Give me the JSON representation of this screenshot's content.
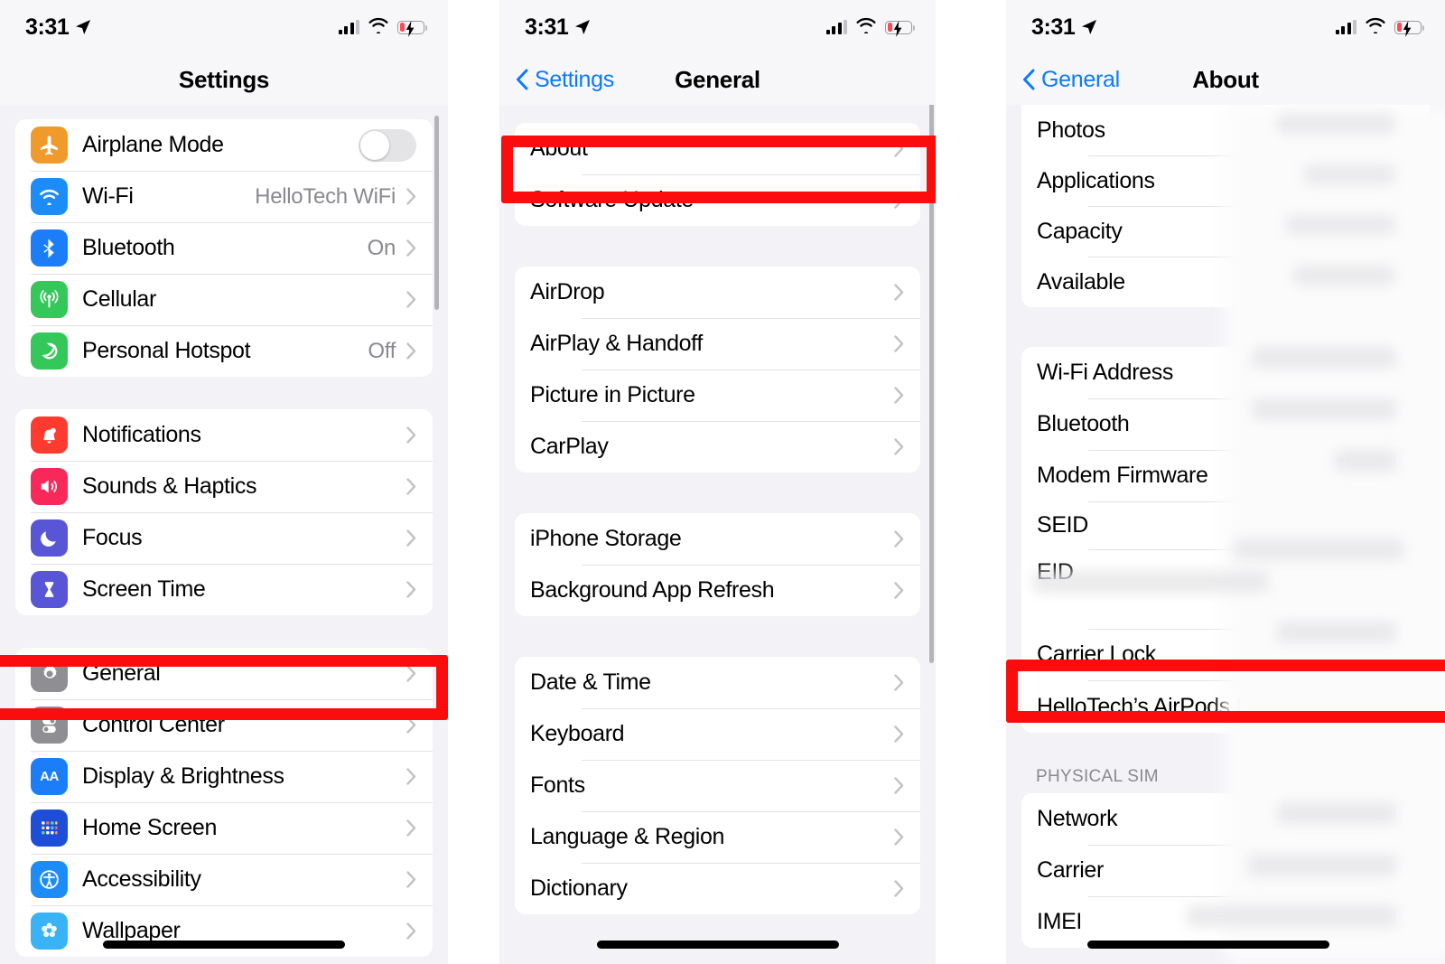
{
  "status_bar": {
    "time": "3:31",
    "location_icon": "location-arrow-icon",
    "signal_icon": "cellular-signal-icon",
    "wifi_icon": "wifi-icon",
    "battery_icon": "battery-charging-icon"
  },
  "panel_settings": {
    "title": "Settings",
    "groups": [
      {
        "rows": [
          {
            "label": "Airplane Mode",
            "icon": "airplane-icon",
            "color": "#f09a2b",
            "control": "toggle",
            "value": ""
          },
          {
            "label": "Wi-Fi",
            "icon": "wifi-icon",
            "color": "#1c8cf9",
            "control": "chevron",
            "value": "HelloTech WiFi"
          },
          {
            "label": "Bluetooth",
            "icon": "bluetooth-icon",
            "color": "#1c7df9",
            "control": "chevron",
            "value": "On"
          },
          {
            "label": "Cellular",
            "icon": "cellular-icon",
            "color": "#34c759",
            "control": "chevron",
            "value": ""
          },
          {
            "label": "Personal Hotspot",
            "icon": "hotspot-icon",
            "color": "#34c759",
            "control": "chevron",
            "value": "Off"
          }
        ]
      },
      {
        "rows": [
          {
            "label": "Notifications",
            "icon": "notifications-bell-icon",
            "color": "#ff3b30",
            "control": "chevron",
            "value": ""
          },
          {
            "label": "Sounds & Haptics",
            "icon": "sounds-speaker-icon",
            "color": "#f8285a",
            "control": "chevron",
            "value": ""
          },
          {
            "label": "Focus",
            "icon": "focus-moon-icon",
            "color": "#5856d6",
            "control": "chevron",
            "value": ""
          },
          {
            "label": "Screen Time",
            "icon": "screen-time-hourglass-icon",
            "color": "#5856d6",
            "control": "chevron",
            "value": ""
          }
        ]
      },
      {
        "rows": [
          {
            "label": "General",
            "icon": "gear-icon",
            "color": "#8e8e93",
            "control": "chevron",
            "value": ""
          },
          {
            "label": "Control Center",
            "icon": "control-center-icon",
            "color": "#8e8e93",
            "control": "chevron",
            "value": ""
          },
          {
            "label": "Display & Brightness",
            "icon": "display-brightness-aa-icon",
            "color": "#1c7df9",
            "control": "chevron",
            "value": ""
          },
          {
            "label": "Home Screen",
            "icon": "home-screen-grid-icon",
            "color": "#1e4ed8",
            "control": "chevron",
            "value": ""
          },
          {
            "label": "Accessibility",
            "icon": "accessibility-icon",
            "color": "#1c8cf9",
            "control": "chevron",
            "value": ""
          },
          {
            "label": "Wallpaper",
            "icon": "wallpaper-flower-icon",
            "color": "#39b3f5",
            "control": "chevron",
            "value": ""
          }
        ]
      }
    ],
    "highlight": "General"
  },
  "panel_general": {
    "title": "General",
    "back_label": "Settings",
    "groups": [
      {
        "rows": [
          {
            "label": "About"
          },
          {
            "label": "Software Update"
          }
        ]
      },
      {
        "rows": [
          {
            "label": "AirDrop"
          },
          {
            "label": "AirPlay & Handoff"
          },
          {
            "label": "Picture in Picture"
          },
          {
            "label": "CarPlay"
          }
        ]
      },
      {
        "rows": [
          {
            "label": "iPhone Storage"
          },
          {
            "label": "Background App Refresh"
          }
        ]
      },
      {
        "rows": [
          {
            "label": "Date & Time"
          },
          {
            "label": "Keyboard"
          },
          {
            "label": "Fonts"
          },
          {
            "label": "Language & Region"
          },
          {
            "label": "Dictionary"
          }
        ]
      }
    ],
    "highlight": "About"
  },
  "panel_about": {
    "title": "About",
    "back_label": "General",
    "groups": [
      {
        "header": "",
        "rows": [
          {
            "label": "Photos",
            "value": "",
            "redacted": true
          },
          {
            "label": "Applications",
            "value": "",
            "redacted": true
          },
          {
            "label": "Capacity",
            "value": "",
            "redacted": true
          },
          {
            "label": "Available",
            "value": "",
            "redacted": true
          }
        ]
      },
      {
        "header": "",
        "rows": [
          {
            "label": "Wi-Fi Address",
            "value": "",
            "redacted": true
          },
          {
            "label": "Bluetooth",
            "value": "",
            "redacted": true
          },
          {
            "label": "Modem Firmware",
            "value": "",
            "redacted": true
          },
          {
            "label": "SEID",
            "value": "",
            "redacted": true
          },
          {
            "label": "EID",
            "value": "",
            "redacted": true
          },
          {
            "label": "Carrier Lock",
            "value": "",
            "redacted": true
          },
          {
            "label": "HelloTech’s AirPods Pro",
            "value": "",
            "redacted": false,
            "chevron": true
          }
        ]
      },
      {
        "header": "PHYSICAL SIM",
        "rows": [
          {
            "label": "Network",
            "value": "",
            "redacted": true
          },
          {
            "label": "Carrier",
            "value": "",
            "redacted": true
          },
          {
            "label": "IMEI",
            "value": "",
            "redacted": true
          }
        ]
      }
    ],
    "highlight": "HelloTech’s AirPods Pro"
  },
  "annotation": {
    "color": "#fc0d0d",
    "boxes": [
      "general-row",
      "about-row",
      "airpods-row"
    ]
  }
}
